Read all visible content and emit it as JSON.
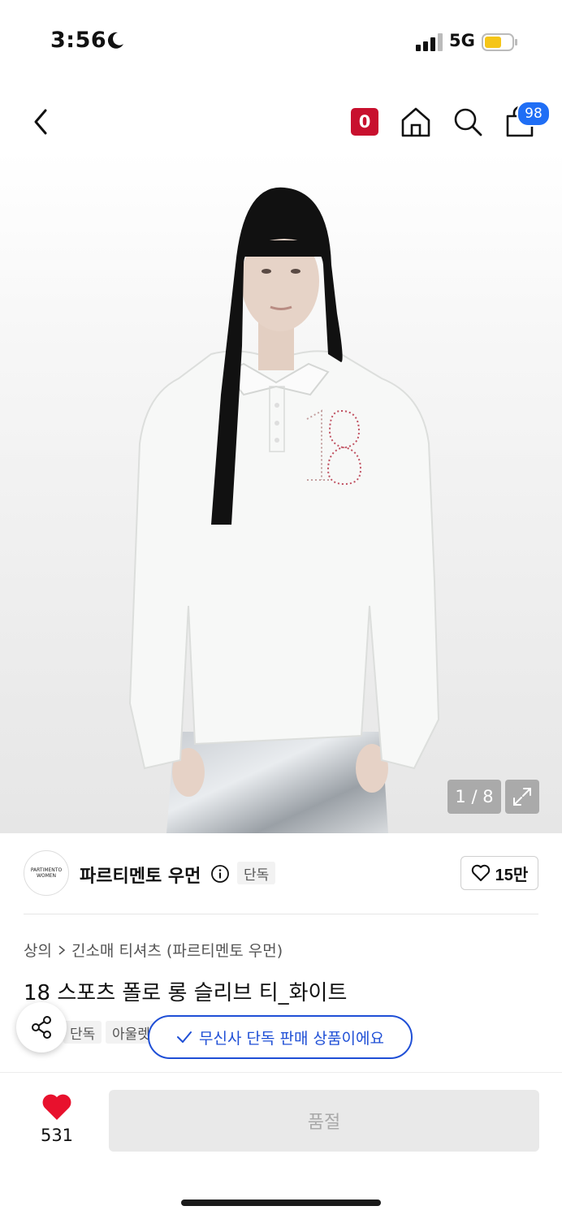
{
  "status_bar": {
    "time": "3:56",
    "network": "5G"
  },
  "header": {
    "points_badge": "0",
    "cart_count": "98"
  },
  "gallery": {
    "counter": "1 / 8"
  },
  "brand": {
    "logo_text_line1": "PARTIMENTO",
    "logo_text_line2": "WOMEN",
    "name": "파르티멘토 우먼",
    "exclusive_label": "단독",
    "likes": "15만"
  },
  "breadcrumb": {
    "items": [
      "상의",
      "긴소매 티셔츠 (파르티멘토 우먼)"
    ]
  },
  "product": {
    "title": "18 스포츠 폴로 롱 슬리브 티_화이트",
    "tags": [
      "단독",
      "아울렛"
    ]
  },
  "toast": {
    "message": "무신사 단독 판매 상품이에요"
  },
  "bottom_bar": {
    "like_count": "531",
    "buy_label": "품절"
  },
  "colors": {
    "accent_blue": "#1f4fd6",
    "badge_red": "#c8102e",
    "heart_red": "#e8112d",
    "battery_yellow": "#f5c518"
  }
}
